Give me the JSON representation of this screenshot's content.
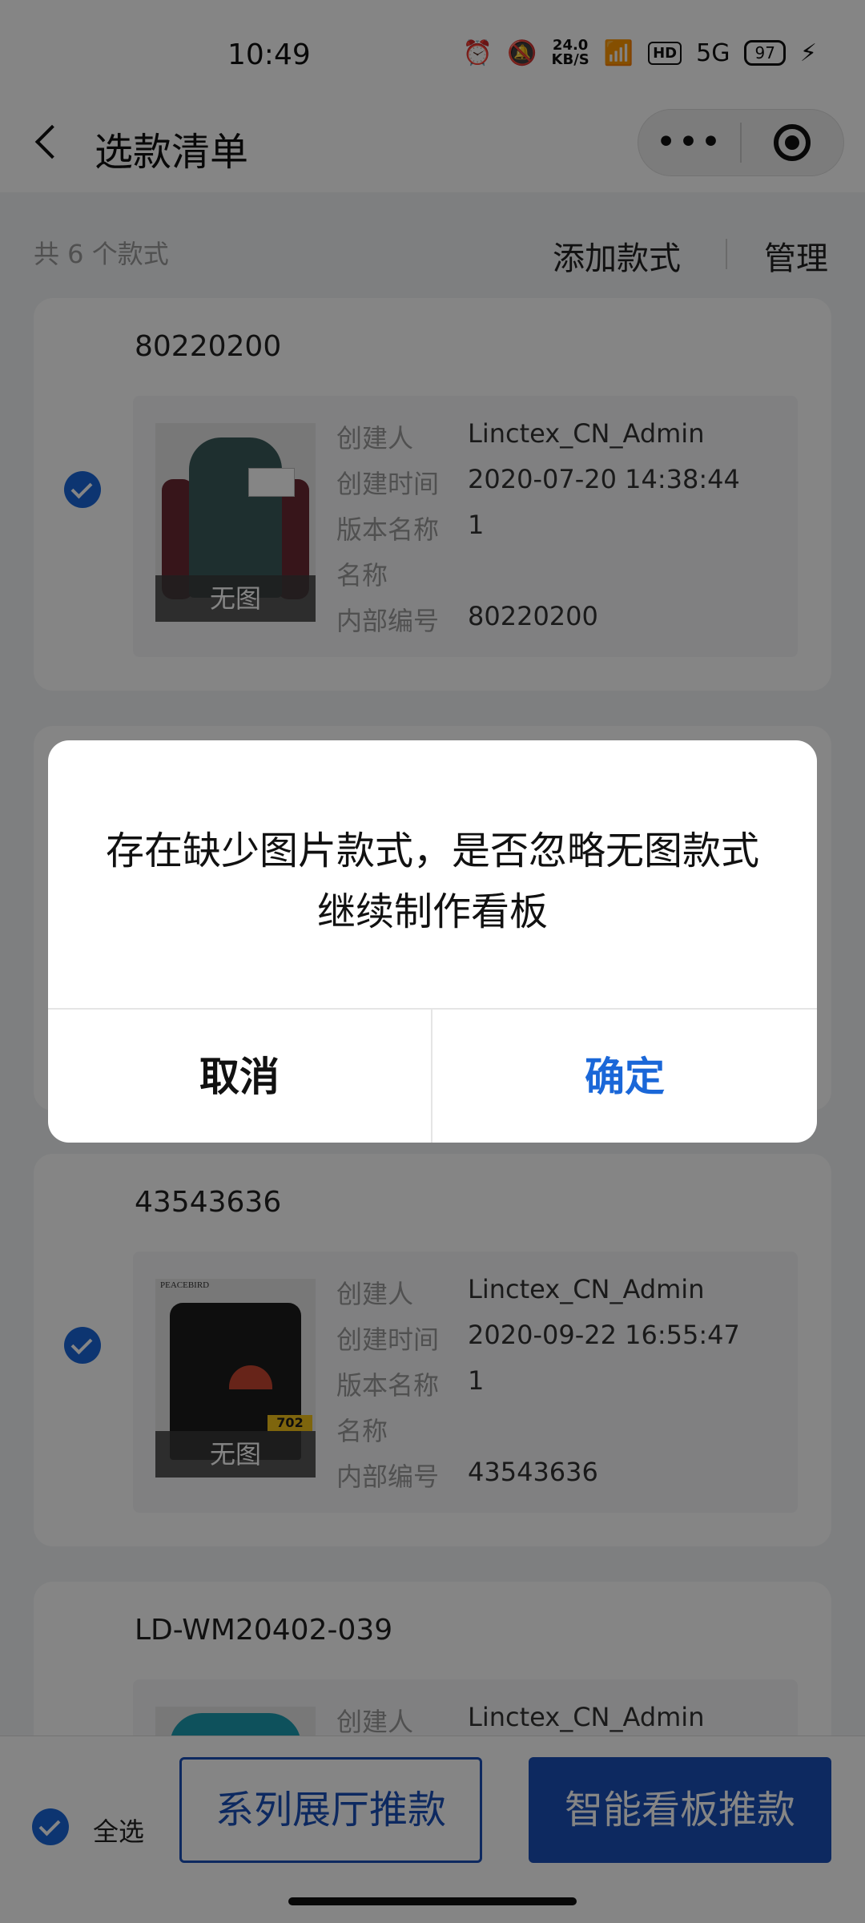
{
  "status_bar": {
    "time": "10:49",
    "net_speed_value": "24.0",
    "net_speed_unit": "KB/S",
    "hd": "HD",
    "signal": "5G",
    "battery": "97"
  },
  "nav": {
    "title": "选款清单"
  },
  "list_header": {
    "count": "共 6 个款式",
    "add": "添加款式",
    "manage": "管理"
  },
  "styles": [
    {
      "code": "80220200",
      "checked": true,
      "no_image": "无图",
      "fields": [
        {
          "k": "创建人",
          "v": "Linctex_CN_Admin"
        },
        {
          "k": "创建时间",
          "v": "2020-07-20 14:38:44"
        },
        {
          "k": "版本名称",
          "v": "1"
        },
        {
          "k": "名称",
          "v": ""
        },
        {
          "k": "内部编号",
          "v": "80220200"
        }
      ]
    },
    {
      "code": "43543636",
      "checked": true,
      "no_image": "无图",
      "brand": "PEACEBIRD",
      "price": "702",
      "fields": [
        {
          "k": "创建人",
          "v": "Linctex_CN_Admin"
        },
        {
          "k": "创建时间",
          "v": "2020-09-22 16:55:47"
        },
        {
          "k": "版本名称",
          "v": "1"
        },
        {
          "k": "名称",
          "v": ""
        },
        {
          "k": "内部编号",
          "v": "43543636"
        }
      ]
    },
    {
      "code": "LD-WM20402-039",
      "checked": true,
      "fields": [
        {
          "k": "创建人",
          "v": "Linctex_CN_Admin"
        }
      ]
    }
  ],
  "bottom_bar": {
    "select_all": "全选",
    "hall_button": "系列展厅推款",
    "board_button": "智能看板推款"
  },
  "dialog": {
    "message": "存在缺少图片款式，是否忽略无图款式继续制作看板",
    "cancel": "取消",
    "confirm": "确定"
  }
}
